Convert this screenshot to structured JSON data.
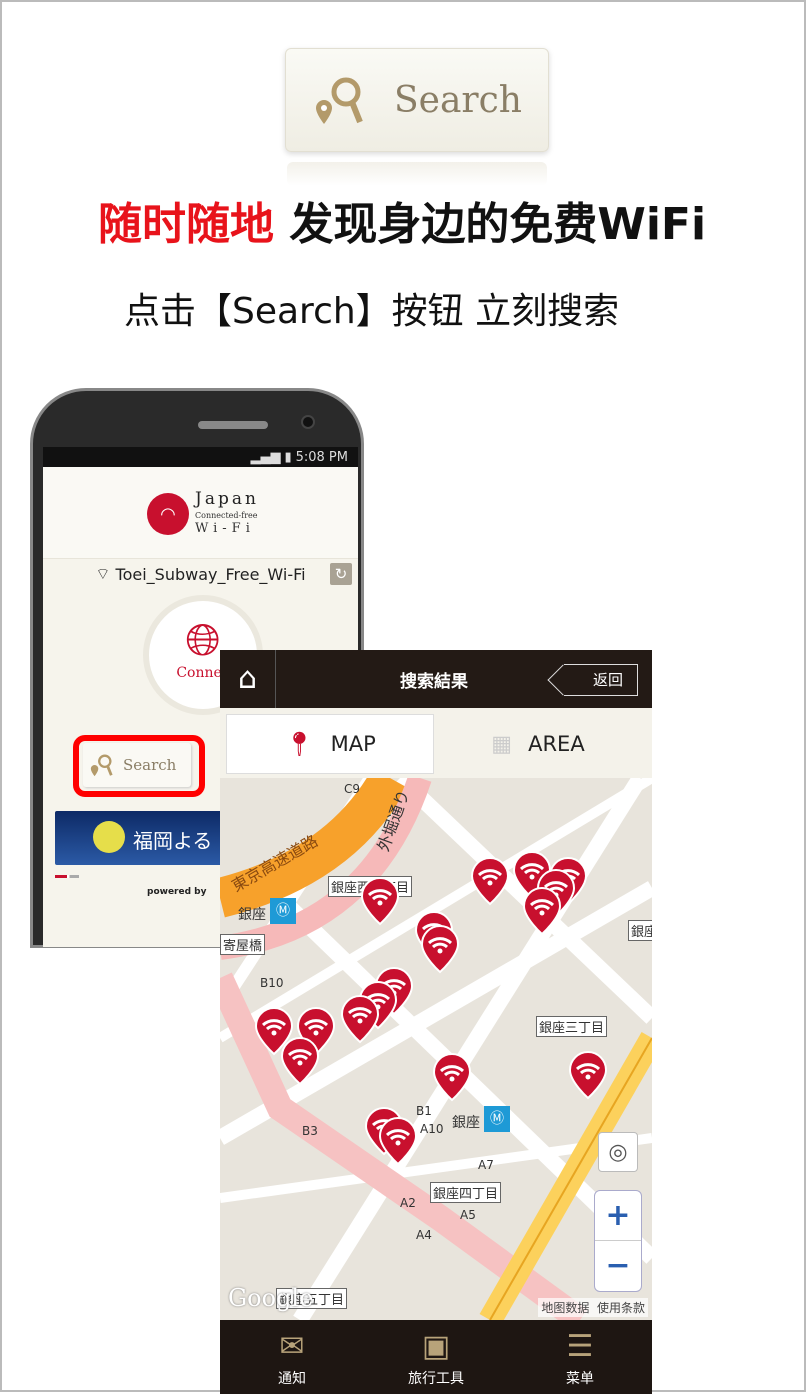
{
  "promo": {
    "top_button_label": "Search",
    "headline_red": "随时随地",
    "headline_black": " 发现身边的免费WiFi",
    "subline": "点击【Search】按钮 立刻搜索",
    "accent_red": "#e8131b"
  },
  "phone1": {
    "status_time": "5:08 PM",
    "logo": {
      "line1": "Japan",
      "line2": "Connected-free",
      "line3": "Wi-Fi"
    },
    "ssid": "Toei_Subway_Free_Wi-Fi",
    "connect_label": "Connec",
    "search_label": "Search",
    "banner_text": "福岡よる",
    "powered_by": "powered by"
  },
  "phone2": {
    "header_title": "搜索結果",
    "back_label": "返回",
    "tabs": [
      {
        "label": "MAP",
        "active": true
      },
      {
        "label": "AREA",
        "active": false
      }
    ],
    "map": {
      "labels": [
        "C9",
        "外堀通り",
        "東京高速道路",
        "銀座西二丁目",
        "銀座",
        "寄屋橋",
        "B10",
        "銀座三丁目",
        "B1",
        "A10",
        "銀座",
        "B3",
        "A7",
        "銀座四丁目",
        "A2",
        "A5",
        "A4",
        "銀座五丁目",
        "銀座"
      ],
      "pin_count": 18,
      "pin_color": "#c8102e",
      "google_logo": "Google",
      "map_data": "地图数据",
      "terms": "使用条款",
      "zoom_in": "+",
      "zoom_out": "−"
    },
    "bottom_nav": [
      {
        "label": "通知",
        "icon": "mail-icon"
      },
      {
        "label": "旅行工具",
        "icon": "suitcase-icon"
      },
      {
        "label": "菜单",
        "icon": "menu-list-icon"
      }
    ]
  }
}
